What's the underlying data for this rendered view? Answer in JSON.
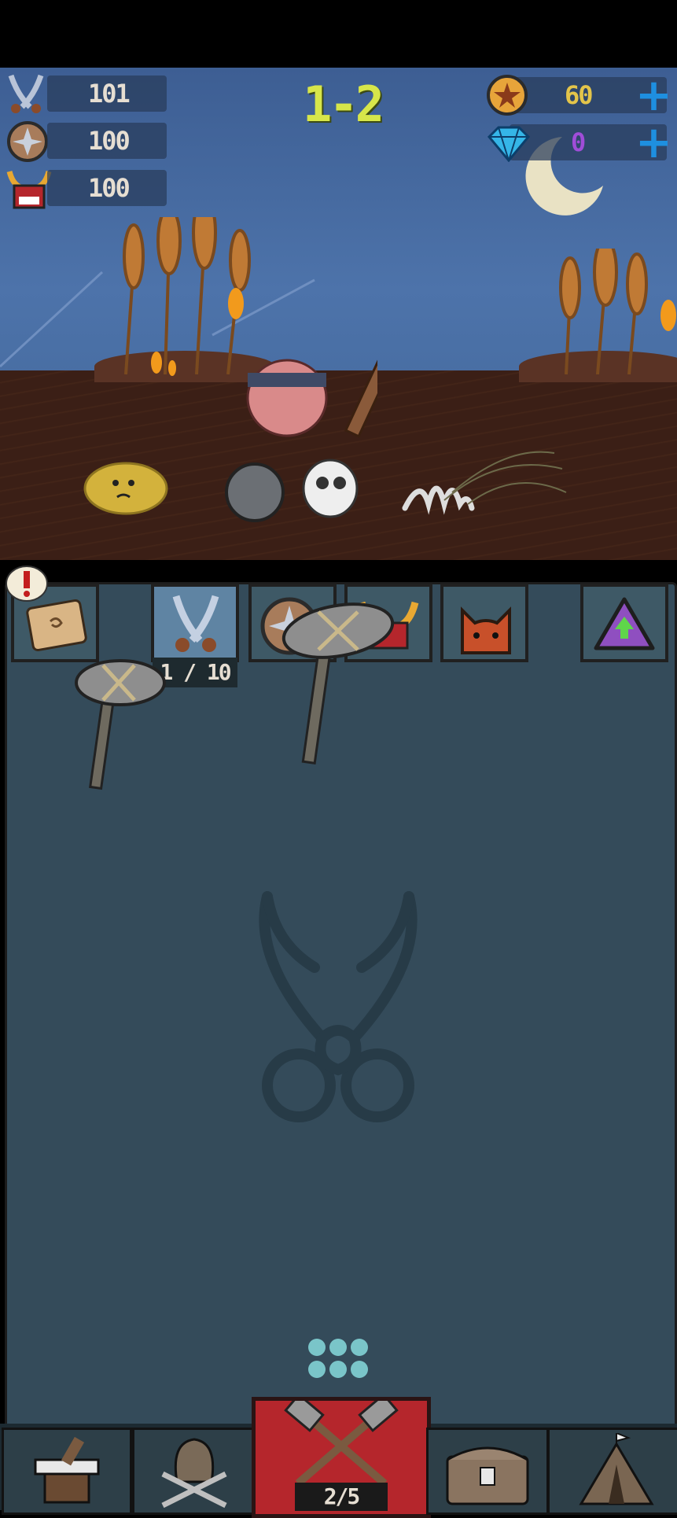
{
  "hud": {
    "attack": "101",
    "defense": "100",
    "health": "100",
    "level": "1-2",
    "gold": "60",
    "gems": "0"
  },
  "inventory": {
    "selected_slot_count": "1 / 10"
  },
  "bottom_nav": {
    "center_counter": "2/5"
  },
  "colors": {
    "level_text": "#d7e64a",
    "gold_text": "#e3c44a",
    "gem_text": "#a04dd8",
    "plus_button": "#1e8fe0",
    "center_button": "#b5262c"
  }
}
